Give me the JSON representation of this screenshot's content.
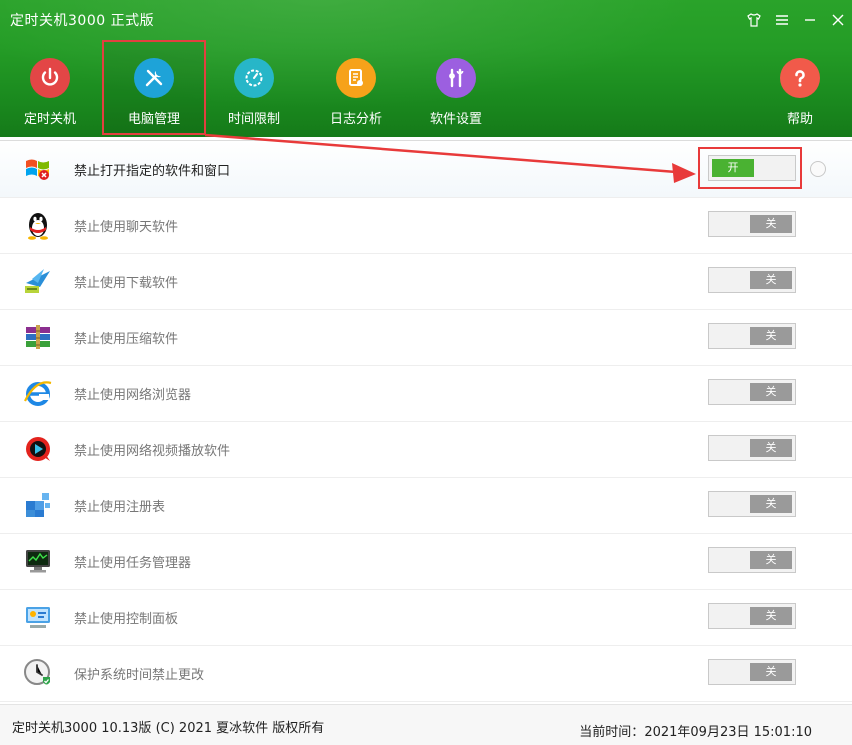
{
  "window": {
    "title": "定时关机3000 正式版"
  },
  "nav": [
    {
      "label": "定时关机",
      "color": "#e34646"
    },
    {
      "label": "电脑管理",
      "color": "#1ea3d8"
    },
    {
      "label": "时间限制",
      "color": "#27b6c8"
    },
    {
      "label": "日志分析",
      "color": "#f6a21a"
    },
    {
      "label": "软件设置",
      "color": "#9c5fe0"
    },
    {
      "label": "帮助",
      "color": "#f15a4a"
    }
  ],
  "rows": [
    {
      "text": "禁止打开指定的软件和窗口",
      "state": "开",
      "icon": "windows-icon"
    },
    {
      "text": "禁止使用聊天软件",
      "state": "关",
      "icon": "qq-penguin-icon"
    },
    {
      "text": "禁止使用下载软件",
      "state": "关",
      "icon": "download-bird-icon"
    },
    {
      "text": "禁止使用压缩软件",
      "state": "关",
      "icon": "archive-books-icon"
    },
    {
      "text": "禁止使用网络浏览器",
      "state": "关",
      "icon": "ie-browser-icon"
    },
    {
      "text": "禁止使用网络视频播放软件",
      "state": "关",
      "icon": "video-player-icon"
    },
    {
      "text": "禁止使用注册表",
      "state": "关",
      "icon": "registry-cubes-icon"
    },
    {
      "text": "禁止使用任务管理器",
      "state": "关",
      "icon": "task-monitor-icon"
    },
    {
      "text": "禁止使用控制面板",
      "state": "关",
      "icon": "control-panel-icon"
    },
    {
      "text": "保护系统时间禁止更改",
      "state": "关",
      "icon": "clock-shield-icon"
    }
  ],
  "footer": {
    "copyright": "定时关机3000 10.13版 (C) 2021  夏冰软件 版权所有",
    "time_label": "当前时间：",
    "time_value": "2021年09月23日 15:01:10"
  }
}
